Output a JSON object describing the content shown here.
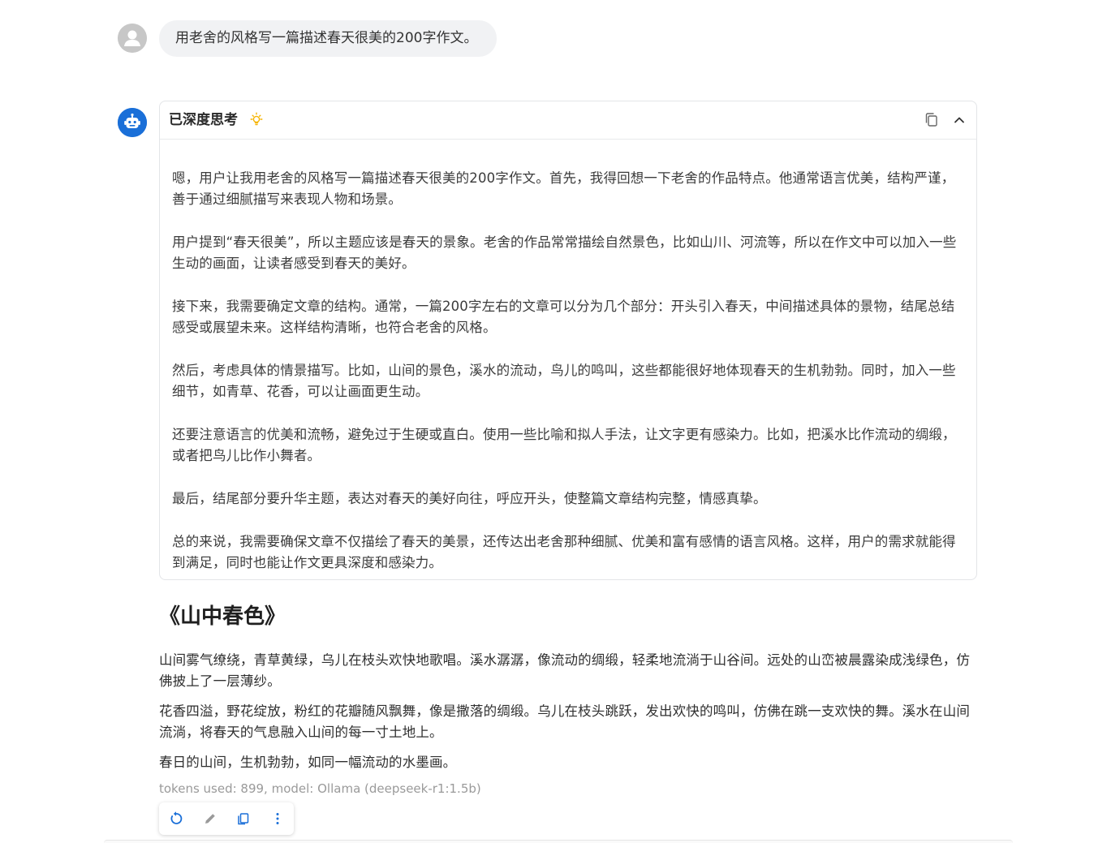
{
  "colors": {
    "accent": "#1a6fd8",
    "user_bubble_bg": "#f1f2f4",
    "bulb": "#f5b400",
    "meta_text": "#9a9a9a"
  },
  "user": {
    "avatar_icon": "user-avatar-icon",
    "message": "用老舍的风格写一篇描述春天很美的200字作文。"
  },
  "bot": {
    "avatar_icon": "robot-icon"
  },
  "thinking": {
    "title": "已深度思考",
    "icons": [
      "lightbulb-icon",
      "copy-icon",
      "chevron-up-icon"
    ],
    "paragraphs": [
      "嗯，用户让我用老舍的风格写一篇描述春天很美的200字作文。首先，我得回想一下老舍的作品特点。他通常语言优美，结构严谨，善于通过细腻描写来表现人物和场景。",
      "用户提到“春天很美”，所以主题应该是春天的景象。老舍的作品常常描绘自然景色，比如山川、河流等，所以在作文中可以加入一些生动的画面，让读者感受到春天的美好。",
      "接下来，我需要确定文章的结构。通常，一篇200字左右的文章可以分为几个部分：开头引入春天，中间描述具体的景物，结尾总结感受或展望未来。这样结构清晰，也符合老舍的风格。",
      "然后，考虑具体的情景描写。比如，山间的景色，溪水的流动，鸟儿的鸣叫，这些都能很好地体现春天的生机勃勃。同时，加入一些细节，如青草、花香，可以让画面更生动。",
      "还要注意语言的优美和流畅，避免过于生硬或直白。使用一些比喻和拟人手法，让文字更有感染力。比如，把溪水比作流动的绸缎，或者把鸟儿比作小舞者。",
      "最后，结尾部分要升华主题，表达对春天的美好向往，呼应开头，使整篇文章结构完整，情感真挚。",
      "总的来说，我需要确保文章不仅描绘了春天的美景，还传达出老舍那种细腻、优美和富有感情的语言风格。这样，用户的需求就能得到满足，同时也能让作文更具深度和感染力。"
    ]
  },
  "answer": {
    "title": "《山中春色》",
    "paragraphs": [
      "山间雾气缭绕，青草黄绿，乌儿在枝头欢快地歌唱。溪水潺潺，像流动的绸缎，轻柔地流淌于山谷间。远处的山峦被晨露染成浅绿色，仿佛披上了一层薄纱。",
      "花香四溢，野花绽放，粉红的花瓣随风飘舞，像是撒落的绸缎。乌儿在枝头跳跃，发出欢快的鸣叫，仿佛在跳一支欢快的舞。溪水在山间流淌，将春天的气息融入山间的每一寸土地上。",
      "春日的山间，生机勃勃，如同一幅流动的水墨画。"
    ],
    "meta": "tokens used: 899, model: Ollama (deepseek-r1:1.5b)"
  },
  "actions": {
    "icons": [
      "refresh-icon",
      "edit-icon",
      "copy-icon",
      "more-icon"
    ]
  }
}
